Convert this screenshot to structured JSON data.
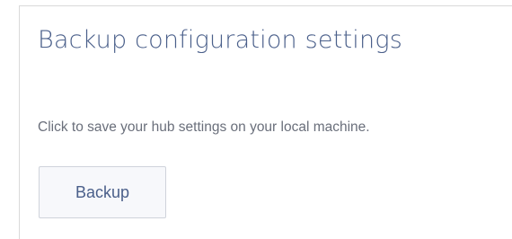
{
  "section": {
    "title": "Backup configuration settings",
    "description": "Click to save your hub settings on your local machine.",
    "backup_label": "Backup"
  }
}
